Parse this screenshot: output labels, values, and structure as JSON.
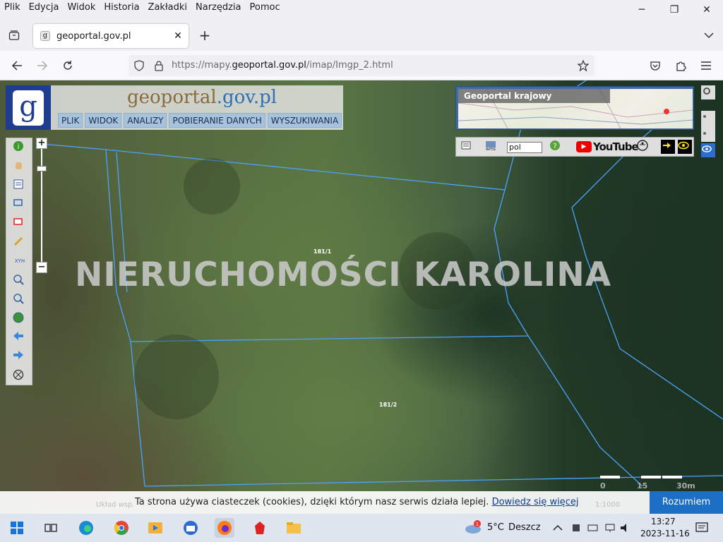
{
  "menubar": {
    "items": [
      "Plik",
      "Edycja",
      "Widok",
      "Historia",
      "Zakładki",
      "Narzędzia",
      "Pomoc"
    ]
  },
  "window": {
    "minimize": "─",
    "restore": "❐",
    "close": "✕"
  },
  "tab": {
    "title": "geoportal.gov.pl",
    "favicon": "g",
    "close": "✕",
    "new_tab": "+"
  },
  "nav": {
    "url_prefix": "https://mapy.",
    "url_domain": "geoportal.gov.pl",
    "url_path": "/imap/Imgp_2.html"
  },
  "geoportal": {
    "logo_letter": "g",
    "brand_prefix": "geoportal",
    "brand_suffix": ".gov.pl",
    "menu": [
      "PLIK",
      "WIDOK",
      "ANALIZY",
      "POBIERANIE DANYCH",
      "WYSZUKIWANIA"
    ],
    "minimap_title": "Geoportal krajowy",
    "language": "pol",
    "youtube": "YouTube",
    "zoom_in": "+",
    "zoom_out": "−"
  },
  "map": {
    "watermark": "NIERUCHOMOŚCI KAROLINA",
    "parcels": [
      "181/1",
      "181/2"
    ],
    "scale_labels": [
      "0",
      "15",
      "30m"
    ],
    "scale_ratio": "1:1000",
    "layer_hint": "Układ wsp."
  },
  "cookie": {
    "text": "Ta strona używa ciasteczek (cookies), dzięki którym nasz serwis działa lepiej.",
    "link": "Dowiedz się więcej",
    "button": "Rozumiem"
  },
  "taskbar": {
    "weather_temp": "5°C",
    "weather_desc": "Deszcz",
    "weather_badge": "1",
    "time": "13:27",
    "date": "2023-11-16"
  },
  "colors": {
    "accent": "#1c6fc4",
    "logo_blue": "#1e3d8f",
    "parcel_line": "#4aa3ff"
  }
}
